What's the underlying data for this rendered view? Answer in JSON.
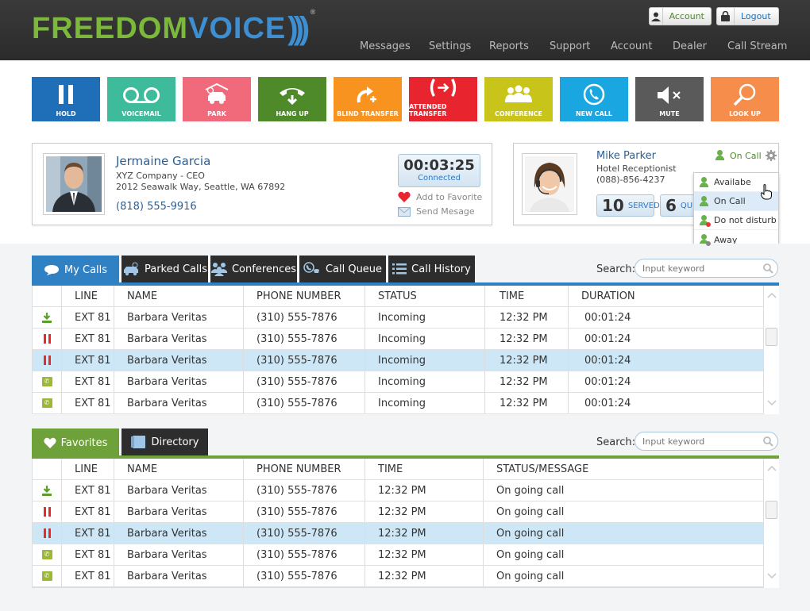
{
  "header": {
    "logo": {
      "part1": "FREEDOM",
      "part2": "VOICE",
      "waves": ")))",
      "reg": "®"
    },
    "account_button": "Account",
    "logout_button": "Logout",
    "nav": [
      "Messages",
      "Settings",
      "Reports",
      "Support",
      "Account",
      "Dealer",
      "Call Stream"
    ]
  },
  "actions": [
    {
      "label": "HOLD",
      "icon": "pause-icon",
      "color": "#1f6fb8"
    },
    {
      "label": "VOICEMAIL",
      "icon": "voicemail-icon",
      "color": "#3dbb9a"
    },
    {
      "label": "PARK",
      "icon": "car-icon",
      "color": "#f06a7c"
    },
    {
      "label": "HANG UP",
      "icon": "hangup-icon",
      "color": "#4e8a2a"
    },
    {
      "label": "BLIND TRANSFER",
      "icon": "blind-transfer-icon",
      "color": "#f7931e"
    },
    {
      "label": "ATTENDED TRANSFER",
      "icon": "attended-transfer-icon",
      "color": "#e8242f"
    },
    {
      "label": "CONFERENCE",
      "icon": "conference-icon",
      "color": "#c9c41a"
    },
    {
      "label": "NEW CALL",
      "icon": "new-call-icon",
      "color": "#1aa6e0"
    },
    {
      "label": "MUTE",
      "icon": "mute-icon",
      "color": "#5a5a5a"
    },
    {
      "label": "LOOK UP",
      "icon": "lookup-icon",
      "color": "#f78d4a"
    }
  ],
  "caller": {
    "name": "Jermaine Garcia",
    "company": "XYZ Company - CEO",
    "address": "2012 Seawalk Way, Seattle, WA 67892",
    "phone": "(818) 555-9916",
    "timer": "00:03:25",
    "timer_status": "Connected",
    "add_favorite": "Add to Favorite",
    "send_message": "Send Mesage"
  },
  "agent": {
    "name": "Mike Parker",
    "title": "Hotel Receptionist",
    "phone": "(088)-856-4237",
    "status": "On Call",
    "served_count": "10",
    "served_label": "SERVED",
    "queue_count": "6",
    "queue_label": "QU"
  },
  "status_dropdown": [
    {
      "label": "Availabe",
      "dot": ""
    },
    {
      "label": "On Call",
      "dot": ""
    },
    {
      "label": "Do not disturb",
      "dot": "#e53935"
    },
    {
      "label": "Away",
      "dot": "#888888"
    }
  ],
  "calls_tabs": [
    "My Calls",
    "Parked Calls",
    "Conferences",
    "Call Queue",
    "Call History"
  ],
  "search_label": "Search:",
  "search_placeholder": "Input keyword",
  "calls_table": {
    "columns": [
      "LINE",
      "NAME",
      "PHONE NUMBER",
      "STATUS",
      "TIME",
      "DURATION"
    ],
    "rows": [
      {
        "icon": "download",
        "line": "EXT 81",
        "name": "Barbara Veritas",
        "phone": "(310) 555-7876",
        "status": "Incoming",
        "time": "12:32 PM",
        "duration": "00:01:24"
      },
      {
        "icon": "pause",
        "line": "EXT 81",
        "name": "Barbara Veritas",
        "phone": "(310) 555-7876",
        "status": "Incoming",
        "time": "12:32 PM",
        "duration": "00:01:24"
      },
      {
        "icon": "pause",
        "line": "EXT 81",
        "name": "Barbara Veritas",
        "phone": "(310) 555-7876",
        "status": "Incoming",
        "time": "12:32 PM",
        "duration": "00:01:24"
      },
      {
        "icon": "phone",
        "line": "EXT 81",
        "name": "Barbara Veritas",
        "phone": "(310) 555-7876",
        "status": "Incoming",
        "time": "12:32 PM",
        "duration": "00:01:24"
      },
      {
        "icon": "phone",
        "line": "EXT 81",
        "name": "Barbara Veritas",
        "phone": "(310) 555-7876",
        "status": "Incoming",
        "time": "12:32 PM",
        "duration": "00:01:24"
      }
    ]
  },
  "fav_tabs": [
    "Favorites",
    "Directory"
  ],
  "fav_table": {
    "columns": [
      "LINE",
      "NAME",
      "PHONE NUMBER",
      "TIME",
      "STATUS/MESSAGE"
    ],
    "rows": [
      {
        "icon": "download",
        "line": "EXT 81",
        "name": "Barbara Veritas",
        "phone": "(310) 555-7876",
        "time": "12:32 PM",
        "status": "On going call"
      },
      {
        "icon": "pause",
        "line": "EXT 81",
        "name": "Barbara Veritas",
        "phone": "(310) 555-7876",
        "time": "12:32 PM",
        "status": "On going call"
      },
      {
        "icon": "pause",
        "line": "EXT 81",
        "name": "Barbara Veritas",
        "phone": "(310) 555-7876",
        "time": "12:32 PM",
        "status": "On going call"
      },
      {
        "icon": "phone",
        "line": "EXT 81",
        "name": "Barbara Veritas",
        "phone": "(310) 555-7876",
        "time": "12:32 PM",
        "status": "On going call"
      },
      {
        "icon": "phone",
        "line": "EXT 81",
        "name": "Barbara Veritas",
        "phone": "(310) 555-7876",
        "time": "12:32 PM",
        "status": "On going call"
      }
    ]
  }
}
